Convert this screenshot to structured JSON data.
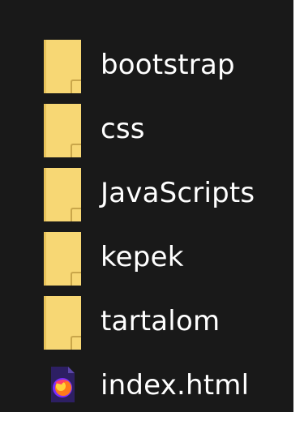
{
  "explorer": {
    "items": [
      {
        "name": "bootstrap",
        "icon": "folder-icon",
        "type": "folder"
      },
      {
        "name": "css",
        "icon": "folder-icon",
        "type": "folder"
      },
      {
        "name": "JavaScripts",
        "icon": "folder-icon",
        "type": "folder"
      },
      {
        "name": "kepek",
        "icon": "folder-icon",
        "type": "folder"
      },
      {
        "name": "tartalom",
        "icon": "folder-icon",
        "type": "folder"
      },
      {
        "name": "index.html",
        "icon": "firefox-html-file-icon",
        "type": "file"
      }
    ]
  },
  "colors": {
    "background": "#191919",
    "text": "#ffffff",
    "folder": "#f7d774",
    "folder_shadow": "#c9a64a",
    "file_page": "#3b2a7a",
    "firefox_orange": "#ff7a1a",
    "firefox_purple": "#7b2cff"
  }
}
